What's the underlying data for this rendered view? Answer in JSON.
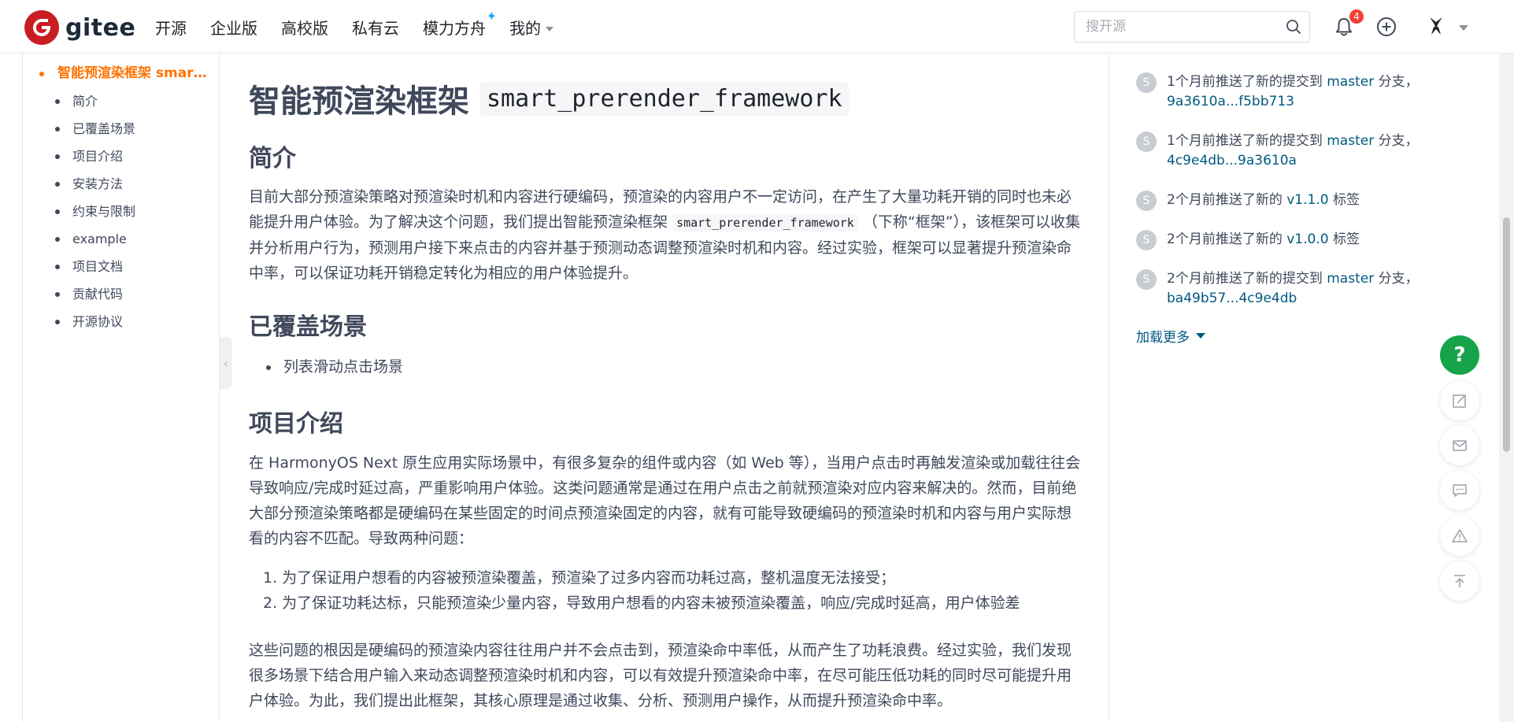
{
  "navbar": {
    "logo_text": "gitee",
    "items": [
      {
        "label": "开源"
      },
      {
        "label": "企业版"
      },
      {
        "label": "高校版"
      },
      {
        "label": "私有云"
      },
      {
        "label": "模力方舟"
      },
      {
        "label": "我的"
      }
    ],
    "search_placeholder": "搜开源",
    "notification_count": "4"
  },
  "toc": {
    "items": [
      {
        "label": "智能预渲染框架 smar…",
        "active": true
      },
      {
        "label": "简介"
      },
      {
        "label": "已覆盖场景"
      },
      {
        "label": "项目介绍"
      },
      {
        "label": "安装方法"
      },
      {
        "label": "约束与限制"
      },
      {
        "label": "example"
      },
      {
        "label": "项目文档"
      },
      {
        "label": "贡献代码"
      },
      {
        "label": "开源协议"
      }
    ]
  },
  "readme": {
    "title": "智能预渲染框架",
    "title_code": "smart_prerender_framework",
    "intro_heading": "简介",
    "intro_p1_a": "目前大部分预渲染策略对预渲染时机和内容进行硬编码，预渲染的内容用户不一定访问，在产生了大量功耗开销的同时也未必能提升用户体验。为了解决这个问题，我们提出智能预渲染框架",
    "intro_p1_code": "smart_prerender_framework",
    "intro_p1_b": "（下称“框架”），该框架可以收集并分析用户行为，预测用户接下来点击的内容并基于预测动态调整预渲染时机和内容。经过实验，框架可以显著提升预渲染命中率，可以保证功耗开销稳定转化为相应的用户体验提升。",
    "scenes_heading": "已覆盖场景",
    "scenes": [
      "列表滑动点击场景"
    ],
    "project_heading": "项目介绍",
    "project_p1": "在 HarmonyOS Next 原生应用实际场景中，有很多复杂的组件或内容（如 Web 等），当用户点击时再触发渲染或加载往往会导致响应/完成时延过高，严重影响用户体验。这类问题通常是通过在用户点击之前就预渲染对应内容来解决的。然而，目前绝大部分预渲染策略都是硬编码在某些固定的时间点预渲染固定的内容，就有可能导致硬编码的预渲染时机和内容与用户实际想看的内容不匹配。导致两种问题：",
    "problems": [
      "1. 为了保证用户想看的内容被预渲染覆盖，预渲染了过多内容而功耗过高，整机温度无法接受；",
      "2. 为了保证功耗达标，只能预渲染少量内容，导致用户想看的内容未被预渲染覆盖，响应/完成时延高，用户体验差"
    ],
    "project_p2": "这些问题的根因是硬编码的预渲染内容往往用户并不会点击到，预渲染命中率低，从而产生了功耗浪费。经过实验，我们发现很多场景下结合用户输入来动态调整预渲染时机和内容，可以有效提升预渲染命中率，在尽可能压低功耗的同时尽可能提升用户体验。为此，我们提出此框架，其核心原理是通过收集、分析、预测用户操作，从而提升预渲染命中率。"
  },
  "activity": {
    "items": [
      {
        "avatar": "S",
        "prefix": "1个月前推送了新的提交到 ",
        "branch": "master",
        "mid": " 分支，",
        "link": "9a3610a...f5bb713"
      },
      {
        "avatar": "S",
        "prefix": "1个月前推送了新的提交到 ",
        "branch": "master",
        "mid": " 分支，",
        "link": "4c9e4db...9a3610a"
      },
      {
        "avatar": "S",
        "prefix": "2个月前推送了新的 ",
        "branch": "v1.1.0",
        "mid": " 标签",
        "link": ""
      },
      {
        "avatar": "S",
        "prefix": "2个月前推送了新的 ",
        "branch": "v1.0.0",
        "mid": " 标签",
        "link": ""
      },
      {
        "avatar": "S",
        "prefix": "2个月前推送了新的提交到 ",
        "branch": "master",
        "mid": " 分支，",
        "link": "ba49b57...4c9e4db"
      }
    ],
    "load_more": "加载更多"
  },
  "float": {
    "help_label": "?"
  },
  "colors": {
    "brand": "#c71d23",
    "accent_orange": "#fe7300",
    "link": "#005980",
    "help_green": "#16a34a"
  }
}
